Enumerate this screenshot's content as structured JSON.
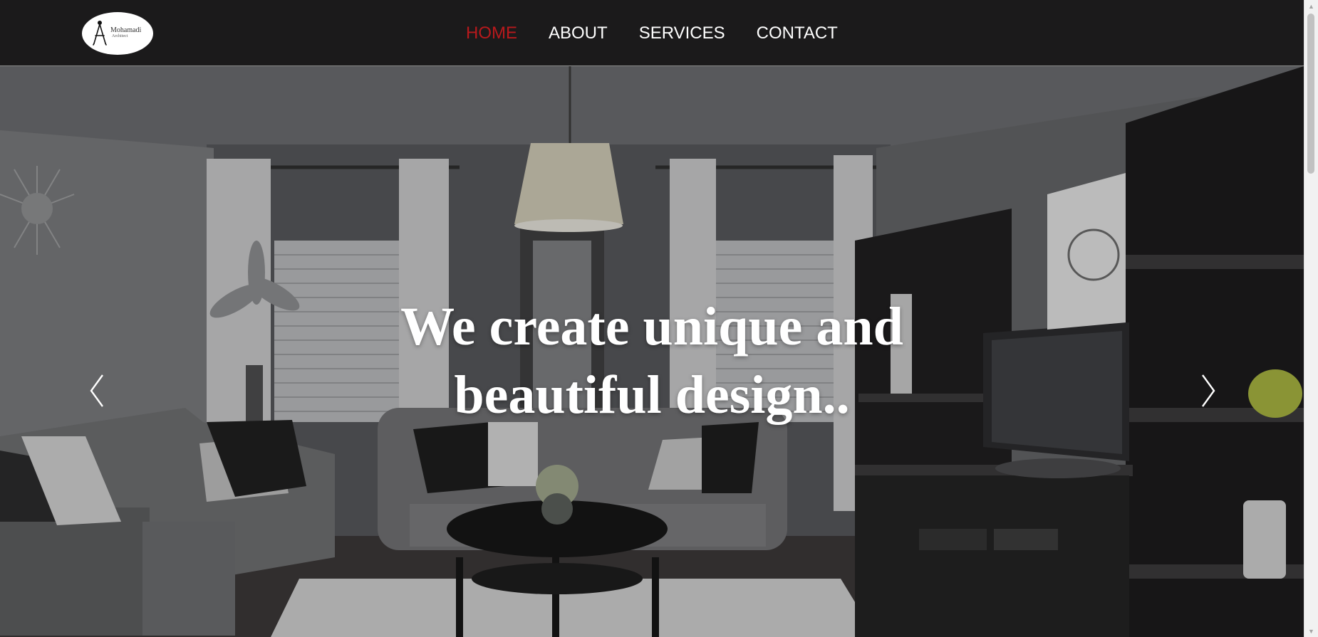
{
  "brand": {
    "logo_line1": "Mohamadi",
    "logo_line2": "Architect"
  },
  "nav": {
    "items": [
      {
        "label": "HOME",
        "active": true
      },
      {
        "label": "ABOUT",
        "active": false
      },
      {
        "label": "SERVICES",
        "active": false
      },
      {
        "label": "CONTACT",
        "active": false
      }
    ],
    "active_color": "#b8191c",
    "text_color": "#ffffff",
    "bar_color": "#1b1a1b"
  },
  "hero": {
    "headline_line1": "We create unique and",
    "headline_line2": "beautiful design..",
    "prev_icon": "chevron-left-icon",
    "next_icon": "chevron-right-icon"
  }
}
